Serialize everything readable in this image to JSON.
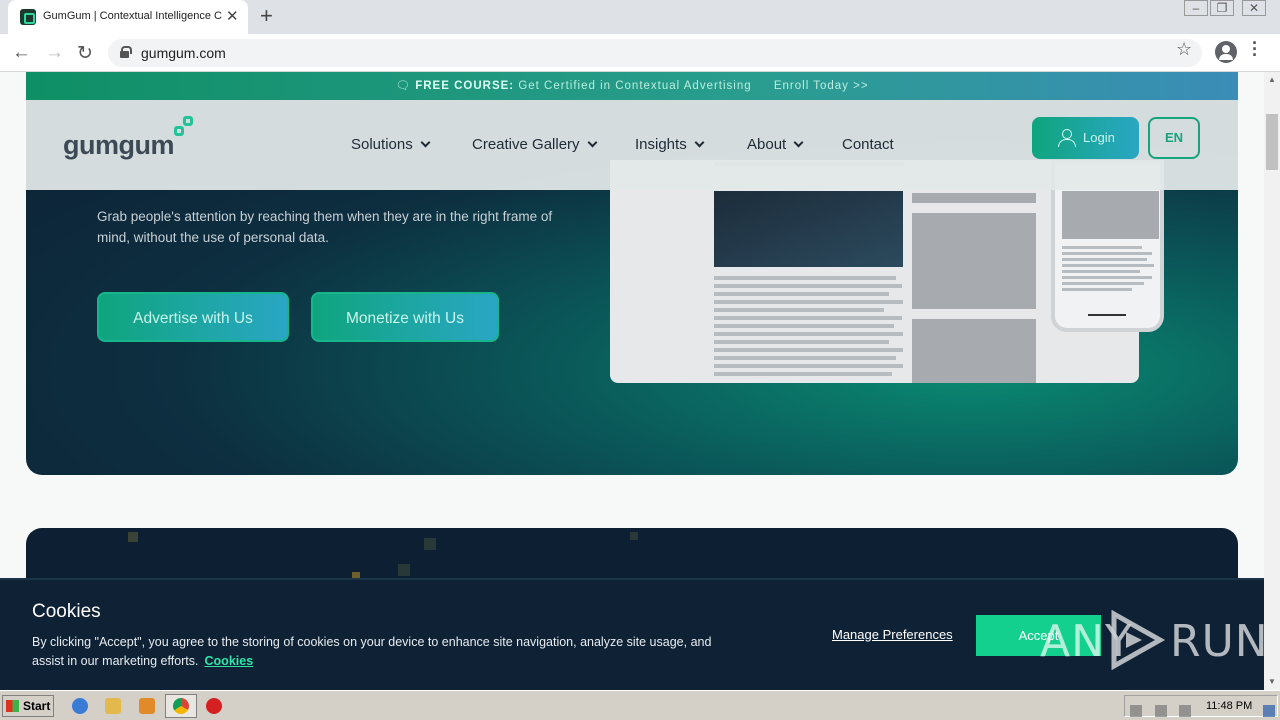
{
  "browser": {
    "tab_title": "GumGum | Contextual Intelligence C",
    "url": "gumgum.com"
  },
  "promo": {
    "prefix": "FREE COURSE:",
    "text": "Get Certified in Contextual Advertising",
    "link": "Enroll Today >>"
  },
  "site": {
    "logo": "gumgum",
    "nav": [
      "Solutions",
      "Creative Gallery",
      "Insights",
      "About",
      "Contact"
    ],
    "login": "Login",
    "lang": "EN"
  },
  "hero": {
    "subtitle": "Grab people's attention by reaching them when they are in the right frame of mind, without the use of personal data.",
    "cta_advertise": "Advertise with Us",
    "cta_monetize": "Monetize with Us"
  },
  "cookie": {
    "title": "Cookies",
    "text": "By clicking \"Accept\", you agree to the storing of cookies on your device to enhance site navigation, analyze site usage, and assist in our marketing efforts.",
    "link": "Cookies",
    "manage": "Manage Preferences",
    "accept": "Accept"
  },
  "watermark": {
    "text_left": "ANY",
    "text_right": "RUN"
  },
  "taskbar": {
    "start": "Start",
    "time": "11:48 PM"
  },
  "colors": {
    "brand_green": "#13d08f",
    "hero_bg": "#0d1f33",
    "banner_bg": "#0f2235"
  }
}
